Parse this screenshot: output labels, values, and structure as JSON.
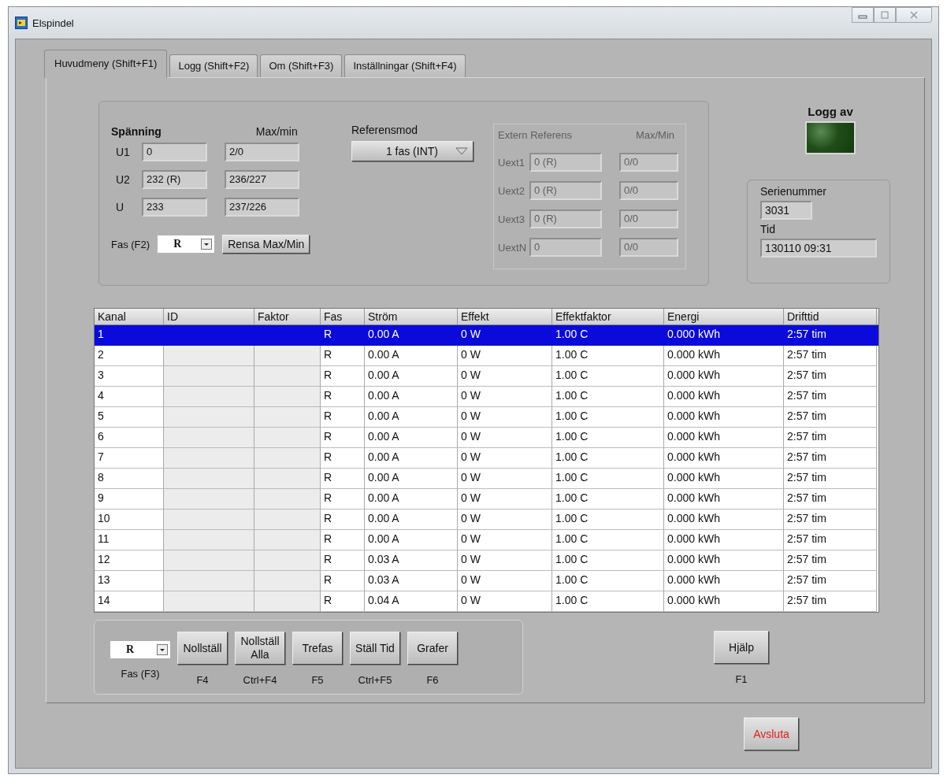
{
  "window": {
    "title": "Elspindel"
  },
  "tabs": [
    {
      "label": "Huvudmeny (Shift+F1)",
      "selected": true
    },
    {
      "label": "Logg (Shift+F2)",
      "selected": false
    },
    {
      "label": "Om (Shift+F3)",
      "selected": false
    },
    {
      "label": "Inställningar (Shift+F4)",
      "selected": false
    }
  ],
  "voltage": {
    "title": "Spänning",
    "maxmin_header": "Max/min",
    "rows": [
      {
        "label": "U1",
        "value": "0",
        "maxmin": "2/0"
      },
      {
        "label": "U2",
        "value": "232 (R)",
        "maxmin": "236/227"
      },
      {
        "label": "U",
        "value": "233",
        "maxmin": "237/226"
      }
    ],
    "phase": {
      "label": "Fas (F2)",
      "value": "R"
    },
    "clear_button": "Rensa Max/Min"
  },
  "reference_mode": {
    "label": "Referensmod",
    "value": "1 fas (INT)"
  },
  "external_reference": {
    "title": "Extern Referens",
    "maxmin_header": "Max/Min",
    "disabled": true,
    "rows": [
      {
        "label": "Uext1",
        "value": "0 (R)",
        "maxmin": "0/0"
      },
      {
        "label": "Uext2",
        "value": "0 (R)",
        "maxmin": "0/0"
      },
      {
        "label": "Uext3",
        "value": "0 (R)",
        "maxmin": "0/0"
      },
      {
        "label": "UextN",
        "value": "0",
        "maxmin": "0/0"
      }
    ]
  },
  "log_indicator": {
    "label": "Logg av",
    "on": false
  },
  "device": {
    "serial_label": "Serienummer",
    "serial": "3031",
    "time_label": "Tid",
    "time": "130110 09:31"
  },
  "table": {
    "columns": [
      "Kanal",
      "ID",
      "Faktor",
      "Fas",
      "Ström",
      "Effekt",
      "Effektfaktor",
      "Energi",
      "Drifttid"
    ],
    "rows": [
      {
        "selected": true,
        "cells": [
          "1",
          "",
          "",
          "R",
          "0.00 A",
          "0 W",
          "1.00 C",
          "0.000 kWh",
          "2:57 tim"
        ]
      },
      {
        "selected": false,
        "cells": [
          "2",
          "",
          "",
          "R",
          "0.00 A",
          "0 W",
          "1.00 C",
          "0.000 kWh",
          "2:57 tim"
        ]
      },
      {
        "selected": false,
        "cells": [
          "3",
          "",
          "",
          "R",
          "0.00 A",
          "0 W",
          "1.00 C",
          "0.000 kWh",
          "2:57 tim"
        ]
      },
      {
        "selected": false,
        "cells": [
          "4",
          "",
          "",
          "R",
          "0.00 A",
          "0 W",
          "1.00 C",
          "0.000 kWh",
          "2:57 tim"
        ]
      },
      {
        "selected": false,
        "cells": [
          "5",
          "",
          "",
          "R",
          "0.00 A",
          "0 W",
          "1.00 C",
          "0.000 kWh",
          "2:57 tim"
        ]
      },
      {
        "selected": false,
        "cells": [
          "6",
          "",
          "",
          "R",
          "0.00 A",
          "0 W",
          "1.00 C",
          "0.000 kWh",
          "2:57 tim"
        ]
      },
      {
        "selected": false,
        "cells": [
          "7",
          "",
          "",
          "R",
          "0.00 A",
          "0 W",
          "1.00 C",
          "0.000 kWh",
          "2:57 tim"
        ]
      },
      {
        "selected": false,
        "cells": [
          "8",
          "",
          "",
          "R",
          "0.00 A",
          "0 W",
          "1.00 C",
          "0.000 kWh",
          "2:57 tim"
        ]
      },
      {
        "selected": false,
        "cells": [
          "9",
          "",
          "",
          "R",
          "0.00 A",
          "0 W",
          "1.00 C",
          "0.000 kWh",
          "2:57 tim"
        ]
      },
      {
        "selected": false,
        "cells": [
          "10",
          "",
          "",
          "R",
          "0.00 A",
          "0 W",
          "1.00 C",
          "0.000 kWh",
          "2:57 tim"
        ]
      },
      {
        "selected": false,
        "cells": [
          "11",
          "",
          "",
          "R",
          "0.00 A",
          "0 W",
          "1.00 C",
          "0.000 kWh",
          "2:57 tim"
        ]
      },
      {
        "selected": false,
        "cells": [
          "12",
          "",
          "",
          "R",
          "0.03 A",
          "0 W",
          "1.00 C",
          "0.000 kWh",
          "2:57 tim"
        ]
      },
      {
        "selected": false,
        "cells": [
          "13",
          "",
          "",
          "R",
          "0.03 A",
          "0 W",
          "1.00 C",
          "0.000 kWh",
          "2:57 tim"
        ]
      },
      {
        "selected": false,
        "cells": [
          "14",
          "",
          "",
          "R",
          "0.04 A",
          "0 W",
          "1.00 C",
          "0.000 kWh",
          "2:57 tim"
        ]
      }
    ]
  },
  "actions": {
    "phase": {
      "value": "R",
      "label": "Fas (F3)"
    },
    "buttons": [
      {
        "label": "Nollställ",
        "shortcut": "F4"
      },
      {
        "label": "Nollställ Alla",
        "shortcut": "Ctrl+F4"
      },
      {
        "label": "Trefas",
        "shortcut": "F5"
      },
      {
        "label": "Ställ Tid",
        "shortcut": "Ctrl+F5"
      },
      {
        "label": "Grafer",
        "shortcut": "F6"
      }
    ]
  },
  "help_button": {
    "label": "Hjälp",
    "shortcut": "F1"
  },
  "exit_button": "Avsluta"
}
